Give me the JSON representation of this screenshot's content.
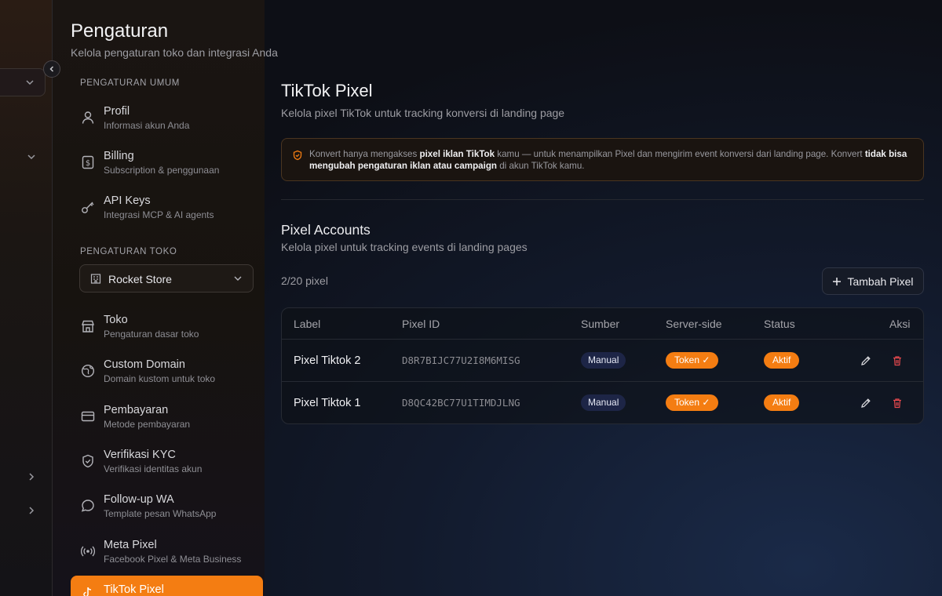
{
  "header": {
    "title": "Pengaturan",
    "subtitle": "Kelola pengaturan toko dan integrasi Anda"
  },
  "sidebar": {
    "section_general": "PENGATURAN UMUM",
    "section_store": "PENGATURAN TOKO",
    "general_items": [
      {
        "title": "Profil",
        "desc": "Informasi akun Anda",
        "icon": "user-icon"
      },
      {
        "title": "Billing",
        "desc": "Subscription & penggunaan",
        "icon": "billing-icon"
      },
      {
        "title": "API Keys",
        "desc": "Integrasi MCP & AI agents",
        "icon": "key-icon"
      }
    ],
    "store_select": {
      "label": "Rocket Store",
      "icon": "store-icon"
    },
    "store_items": [
      {
        "title": "Toko",
        "desc": "Pengaturan dasar toko",
        "icon": "shop-icon"
      },
      {
        "title": "Custom Domain",
        "desc": "Domain kustom untuk toko",
        "icon": "globe-icon"
      },
      {
        "title": "Pembayaran",
        "desc": "Metode pembayaran",
        "icon": "credit-card-icon"
      },
      {
        "title": "Verifikasi KYC",
        "desc": "Verifikasi identitas akun",
        "icon": "shield-check-icon"
      },
      {
        "title": "Follow-up WA",
        "desc": "Template pesan WhatsApp",
        "icon": "chat-icon"
      },
      {
        "title": "Meta Pixel",
        "desc": "Facebook Pixel & Meta Business",
        "icon": "broadcast-icon"
      }
    ],
    "active_item": {
      "title": "TikTok Pixel",
      "icon": "tiktok-icon"
    }
  },
  "main": {
    "title": "TikTok Pixel",
    "subtitle": "Kelola pixel TikTok untuk tracking konversi di landing page",
    "notice": {
      "part1": "Konvert hanya mengakses ",
      "bold1": "pixel iklan TikTok",
      "part2": " kamu — untuk menampilkan Pixel dan mengirim event konversi dari landing page. Konvert ",
      "bold2": "tidak bisa mengubah pengaturan iklan atau campaign",
      "part3": " di akun TikTok kamu."
    },
    "section_title": "Pixel Accounts",
    "section_subtitle": "Kelola pixel untuk tracking events di landing pages",
    "count": "2/20 pixel",
    "add_button": "Tambah Pixel",
    "table": {
      "headers": {
        "label": "Label",
        "pixel_id": "Pixel ID",
        "source": "Sumber",
        "server_side": "Server-side",
        "status": "Status",
        "actions": "Aksi"
      },
      "rows": [
        {
          "label": "Pixel Tiktok 2",
          "pixel_id": "D8R7BIJC77U2I8M6MISG",
          "source": "Manual",
          "server_side": "Token ✓",
          "status": "Aktif"
        },
        {
          "label": "Pixel Tiktok 1",
          "pixel_id": "D8QC42BC77U1TIMDJLNG",
          "source": "Manual",
          "server_side": "Token ✓",
          "status": "Aktif"
        }
      ]
    }
  },
  "colors": {
    "accent": "#f47d12",
    "danger": "#e5484d"
  }
}
